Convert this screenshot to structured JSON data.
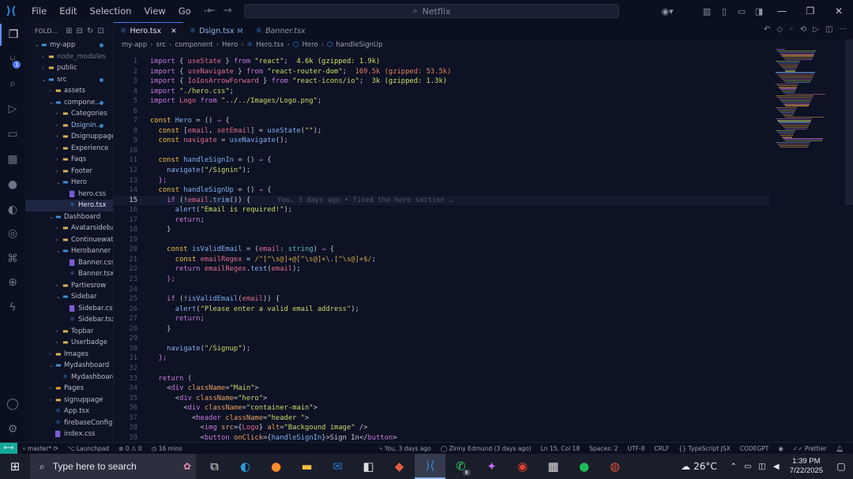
{
  "titlebar": {
    "menu": [
      "File",
      "Edit",
      "Selection",
      "View",
      "Go",
      "···"
    ],
    "search_text": "Netflix"
  },
  "explorer": {
    "header": "FOLD...",
    "rows": [
      {
        "label": "my-app",
        "depth": 0,
        "type": "folder-open",
        "modified": true
      },
      {
        "label": "node_modules",
        "depth": 1,
        "type": "folder",
        "dim": true
      },
      {
        "label": "public",
        "depth": 1,
        "type": "folder"
      },
      {
        "label": "src",
        "depth": 1,
        "type": "folder-open",
        "modified": true
      },
      {
        "label": "assets",
        "depth": 2,
        "type": "folder"
      },
      {
        "label": "compone...",
        "depth": 2,
        "type": "folder-open",
        "modified": true
      },
      {
        "label": "Categories",
        "depth": 3,
        "type": "folder"
      },
      {
        "label": "Dsignin...",
        "depth": 3,
        "type": "folder",
        "modified": true
      },
      {
        "label": "Dsignuppage",
        "depth": 3,
        "type": "folder"
      },
      {
        "label": "Experience",
        "depth": 3,
        "type": "folder"
      },
      {
        "label": "Faqs",
        "depth": 3,
        "type": "folder"
      },
      {
        "label": "Footer",
        "depth": 3,
        "type": "folder"
      },
      {
        "label": "Hero",
        "depth": 3,
        "type": "folder-open"
      },
      {
        "label": "hero.css",
        "depth": 4,
        "type": "css"
      },
      {
        "label": "Hero.tsx",
        "depth": 4,
        "type": "ts",
        "selected": true
      },
      {
        "label": "Dashboard",
        "depth": 2,
        "type": "folder-open"
      },
      {
        "label": "Avatarsidebar",
        "depth": 3,
        "type": "folder"
      },
      {
        "label": "Continuewatc...",
        "depth": 3,
        "type": "folder"
      },
      {
        "label": "Herobanner",
        "depth": 3,
        "type": "folder-open"
      },
      {
        "label": "Banner.css",
        "depth": 4,
        "type": "css"
      },
      {
        "label": "Banner.tsx",
        "depth": 4,
        "type": "ts"
      },
      {
        "label": "Partiesrow",
        "depth": 3,
        "type": "folder"
      },
      {
        "label": "Sidebar",
        "depth": 3,
        "type": "folder-open"
      },
      {
        "label": "Sidebar.css",
        "depth": 4,
        "type": "css"
      },
      {
        "label": "Sidebar.tsx",
        "depth": 4,
        "type": "ts"
      },
      {
        "label": "Topbar",
        "depth": 3,
        "type": "folder"
      },
      {
        "label": "Userbadge",
        "depth": 3,
        "type": "folder"
      },
      {
        "label": "Images",
        "depth": 2,
        "type": "folder"
      },
      {
        "label": "Mydashboard",
        "depth": 2,
        "type": "folder-open"
      },
      {
        "label": "Mydashboard...",
        "depth": 3,
        "type": "ts"
      },
      {
        "label": "Pages",
        "depth": 2,
        "type": "folder-img"
      },
      {
        "label": "signuppage",
        "depth": 2,
        "type": "folder"
      },
      {
        "label": "App.tsx",
        "depth": 2,
        "type": "ts"
      },
      {
        "label": "firebaseConfig.ts",
        "depth": 2,
        "type": "ts"
      },
      {
        "label": "index.css",
        "depth": 2,
        "type": "css"
      }
    ]
  },
  "tabs": [
    {
      "label": "Hero.tsx",
      "active": true,
      "close": "✕"
    },
    {
      "label": "Dsign.tsx",
      "suffix": "M"
    },
    {
      "label": "Banner.tsx",
      "preview": true
    }
  ],
  "breadcrumb": [
    "my-app",
    "src",
    "component",
    "Hero",
    "Hero.tsx",
    "Hero",
    "handleSignUp"
  ],
  "code": {
    "current_line": 15,
    "blame": "You, 3 days ago • fixed the hero section …",
    "lines": [
      [
        [
          "import ",
          "kp"
        ],
        [
          "{ ",
          "p"
        ],
        [
          "useState",
          "v"
        ],
        [
          " } ",
          "p"
        ],
        [
          "from ",
          "kp"
        ],
        [
          "\"react\"",
          "s"
        ],
        [
          ";  ",
          "p"
        ],
        [
          "4.6k (gzipped: 1.9k)",
          "imp1"
        ]
      ],
      [
        [
          "import ",
          "kp"
        ],
        [
          "{ ",
          "p"
        ],
        [
          "useNavigate",
          "v"
        ],
        [
          " } ",
          "p"
        ],
        [
          "from ",
          "kp"
        ],
        [
          "\"react-router-dom\"",
          "s"
        ],
        [
          ";  ",
          "p"
        ],
        [
          "169.5k (gzipped: 53.5k)",
          "imp2"
        ]
      ],
      [
        [
          "import ",
          "kp"
        ],
        [
          "{ ",
          "p"
        ],
        [
          "IoIosArrowForward",
          "v"
        ],
        [
          " } ",
          "p"
        ],
        [
          "from ",
          "kp"
        ],
        [
          "\"react-icons/io\"",
          "s"
        ],
        [
          ";  ",
          "p"
        ],
        [
          "3k (gzipped: 1.3k)",
          "imp1"
        ]
      ],
      [
        [
          "import ",
          "kp"
        ],
        [
          "\"./hero.css\"",
          "s"
        ],
        [
          ";",
          "p"
        ]
      ],
      [
        [
          "import ",
          "kp"
        ],
        [
          "Logo",
          "v"
        ],
        [
          " from ",
          "kp"
        ],
        [
          "\"../../Images/Logo.png\"",
          "s"
        ],
        [
          ";",
          "p"
        ]
      ],
      [],
      [
        [
          "const ",
          "k"
        ],
        [
          "Hero",
          "f"
        ],
        [
          " = () ",
          "p"
        ],
        [
          "⇒",
          "kp"
        ],
        [
          " {",
          "p"
        ]
      ],
      [
        [
          "  const ",
          "k"
        ],
        [
          "[",
          "p"
        ],
        [
          "email",
          "v"
        ],
        [
          ", ",
          "p"
        ],
        [
          "setEmail",
          "v"
        ],
        [
          "] = ",
          "p"
        ],
        [
          "useState",
          "f"
        ],
        [
          "(",
          "p"
        ],
        [
          "\"\"",
          "s"
        ],
        [
          ");",
          "p"
        ]
      ],
      [
        [
          "  const ",
          "k"
        ],
        [
          "navigate",
          "v"
        ],
        [
          " = ",
          "p"
        ],
        [
          "useNavigate",
          "f"
        ],
        [
          "();",
          "p"
        ]
      ],
      [],
      [
        [
          "  const ",
          "k"
        ],
        [
          "handleSignIn",
          "f"
        ],
        [
          " = () ",
          "p"
        ],
        [
          "⇒",
          "kp"
        ],
        [
          " {",
          "p"
        ]
      ],
      [
        [
          "    navigate",
          "f"
        ],
        [
          "(",
          "p"
        ],
        [
          "\"/Signin\"",
          "s"
        ],
        [
          ");",
          "p"
        ]
      ],
      [
        [
          "  };",
          "kp"
        ]
      ],
      [
        [
          "  const ",
          "k"
        ],
        [
          "handleSignUp",
          "f"
        ],
        [
          " = () ",
          "p"
        ],
        [
          "⇒",
          "kp"
        ],
        [
          " {",
          "p"
        ]
      ],
      [
        [
          "    if ",
          "kp"
        ],
        [
          "(!",
          "p"
        ],
        [
          "email",
          "v"
        ],
        [
          ".",
          "p"
        ],
        [
          "trim",
          "f"
        ],
        [
          "()) {",
          "p"
        ]
      ],
      [
        [
          "      alert",
          "f"
        ],
        [
          "(",
          "p"
        ],
        [
          "\"Email is required!\"",
          "s"
        ],
        [
          ");",
          "p"
        ]
      ],
      [
        [
          "      return",
          "kp"
        ],
        [
          ";",
          "p"
        ]
      ],
      [
        [
          "    }",
          "p"
        ]
      ],
      [],
      [
        [
          "    const ",
          "k"
        ],
        [
          "isValidEmail",
          "f"
        ],
        [
          " = (",
          "p"
        ],
        [
          "email",
          "v"
        ],
        [
          ": ",
          "p"
        ],
        [
          "string",
          "t"
        ],
        [
          ") ",
          "p"
        ],
        [
          "⇒",
          "kp"
        ],
        [
          " {",
          "p"
        ]
      ],
      [
        [
          "      const ",
          "k"
        ],
        [
          "emailRegex",
          "v"
        ],
        [
          " = ",
          "p"
        ],
        [
          "/^[^\\s@]+@[^\\s@]+\\.[^\\s@]+$/",
          "r"
        ],
        [
          ";",
          "p"
        ]
      ],
      [
        [
          "      return ",
          "kp"
        ],
        [
          "emailRegex",
          "v"
        ],
        [
          ".",
          "p"
        ],
        [
          "test",
          "f"
        ],
        [
          "(",
          "p"
        ],
        [
          "email",
          "v"
        ],
        [
          ");",
          "p"
        ]
      ],
      [
        [
          "    };",
          "kp"
        ]
      ],
      [],
      [
        [
          "    if ",
          "kp"
        ],
        [
          "(!",
          "p"
        ],
        [
          "isValidEmail",
          "f"
        ],
        [
          "(",
          "p"
        ],
        [
          "email",
          "v"
        ],
        [
          ")) {",
          "p"
        ]
      ],
      [
        [
          "      alert",
          "f"
        ],
        [
          "(",
          "p"
        ],
        [
          "\"Please enter a valid email address\"",
          "s"
        ],
        [
          ");",
          "p"
        ]
      ],
      [
        [
          "      return",
          "kp"
        ],
        [
          ";",
          "p"
        ]
      ],
      [
        [
          "    }",
          "p"
        ]
      ],
      [],
      [
        [
          "    navigate",
          "f"
        ],
        [
          "(",
          "p"
        ],
        [
          "\"/Signup\"",
          "s"
        ],
        [
          ");",
          "p"
        ]
      ],
      [
        [
          "  };",
          "kp"
        ]
      ],
      [],
      [
        [
          "  return ",
          "kp"
        ],
        [
          "(",
          "p"
        ]
      ],
      [
        [
          "    <",
          "p"
        ],
        [
          "div ",
          "kp"
        ],
        [
          "className",
          "o"
        ],
        [
          "=",
          "p"
        ],
        [
          "\"Main\"",
          "s"
        ],
        [
          ">",
          "p"
        ]
      ],
      [
        [
          "      <",
          "p"
        ],
        [
          "div ",
          "kp"
        ],
        [
          "className",
          "o"
        ],
        [
          "=",
          "p"
        ],
        [
          "\"hero\"",
          "s"
        ],
        [
          ">",
          "p"
        ]
      ],
      [
        [
          "        <",
          "p"
        ],
        [
          "div ",
          "kp"
        ],
        [
          "className",
          "o"
        ],
        [
          "=",
          "p"
        ],
        [
          "\"container-main\"",
          "s"
        ],
        [
          ">",
          "p"
        ]
      ],
      [
        [
          "          <",
          "p"
        ],
        [
          "header ",
          "kp"
        ],
        [
          "className",
          "o"
        ],
        [
          "=",
          "p"
        ],
        [
          "\"header \"",
          "s"
        ],
        [
          ">",
          "p"
        ]
      ],
      [
        [
          "            <",
          "p"
        ],
        [
          "img ",
          "kp"
        ],
        [
          "src",
          "o"
        ],
        [
          "={",
          "p"
        ],
        [
          "Logo",
          "v"
        ],
        [
          "} ",
          "p"
        ],
        [
          "alt",
          "o"
        ],
        [
          "=",
          "p"
        ],
        [
          "\"Backgound image\"",
          "s"
        ],
        [
          " />",
          "p"
        ]
      ],
      [
        [
          "            <",
          "p"
        ],
        [
          "button ",
          "kp"
        ],
        [
          "onClick",
          "o"
        ],
        [
          "={",
          "p"
        ],
        [
          "handleSignIn",
          "f"
        ],
        [
          "}>",
          "p"
        ],
        [
          "Sign In",
          "p"
        ],
        [
          "</",
          "p"
        ],
        [
          "button",
          "kp"
        ],
        [
          ">",
          "p"
        ]
      ]
    ]
  },
  "statusbar": {
    "branch": "master*",
    "launchpad": "Launchpad",
    "errors": "⊗ 0 ⚠ 0",
    "time_spent": "16 mins",
    "blame": "You, 3 days ago",
    "author": "Zinny Edmund (3 days ago)",
    "position": "Ln 15, Col 18",
    "spaces": "Spaces: 2",
    "encoding": "UTF-8",
    "eol": "CRLF",
    "language": "TypeScript JSX",
    "codegpt": "CODEGPT",
    "prettier": "Prettier"
  },
  "taskbar": {
    "search_placeholder": "Type here to search",
    "weather": "26°C",
    "time": "1:39 PM",
    "date": "7/22/2025",
    "whatsapp_count": "8"
  }
}
